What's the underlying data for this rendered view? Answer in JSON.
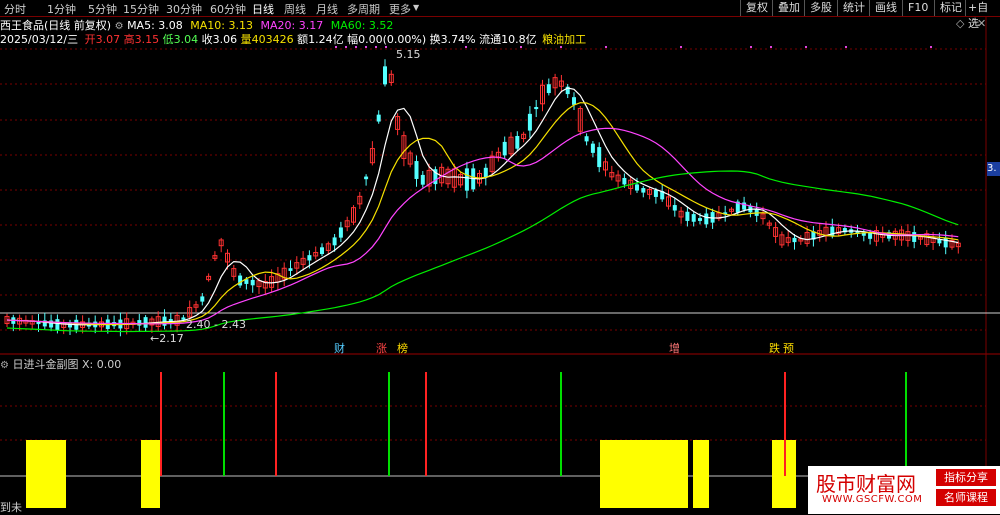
{
  "toolbar": {
    "periods": [
      {
        "label": "分时",
        "active": false
      },
      {
        "label": "1分钟",
        "active": false
      },
      {
        "label": "5分钟",
        "active": false
      },
      {
        "label": "15分钟",
        "active": false
      },
      {
        "label": "30分钟",
        "active": false
      },
      {
        "label": "60分钟",
        "active": false
      },
      {
        "label": "日线",
        "active": true
      },
      {
        "label": "周线",
        "active": false
      },
      {
        "label": "月线",
        "active": false
      },
      {
        "label": "多周期",
        "active": false
      },
      {
        "label": "更多",
        "active": false
      }
    ],
    "right_buttons": [
      "复权",
      "叠加",
      "多股",
      "统计",
      "画线",
      "F10",
      "标记",
      "+自选"
    ]
  },
  "stock": {
    "title": "西王食品(日线 前复权)",
    "ma": [
      {
        "label": "MA5: 3.08",
        "color": "#ffffff"
      },
      {
        "label": "MA10: 3.13",
        "color": "#f5e000"
      },
      {
        "label": "MA20: 3.17",
        "color": "#ff44ff"
      },
      {
        "label": "MA60: 3.52",
        "color": "#00ee00"
      }
    ],
    "date": "2025/03/12/三",
    "open_label": "开",
    "open": "3.07",
    "high_label": "高",
    "high": "3.15",
    "low_label": "低",
    "low": "3.04",
    "close_label": "收",
    "close": "3.06",
    "vol_label": "量",
    "vol": "403426",
    "amount_label": "额",
    "amount": "1.24亿",
    "change_label": "幅",
    "change": "0.00(0.00%)",
    "turnover_label": "换",
    "turnover": "3.74%",
    "float_label": "流通",
    "float": "10.8亿",
    "sector": "粮油加工"
  },
  "price_labels": {
    "max": "5.15",
    "min": "2.17",
    "range": "2.40 - 2.43",
    "axis_tag": "3."
  },
  "colors": {
    "up": "#ff3232",
    "down": "#54ffff",
    "bar_yellow": "#ffff00",
    "signal_green": "#00dd00",
    "signal_red": "#ff2222"
  },
  "events": [
    {
      "label": "财",
      "color": "#54ccff"
    },
    {
      "label": "涨",
      "color": "#ff4444"
    },
    {
      "label": "榜",
      "color": "#ffdd00"
    },
    {
      "label": "增",
      "color": "#ff7777"
    },
    {
      "label": "跌",
      "color": "#ffdd00"
    },
    {
      "label": "预",
      "color": "#ffdd00"
    }
  ],
  "sub": {
    "title": "日进斗金副图",
    "x_label": "X: 0.00",
    "bottom_left": "到未"
  },
  "logo": {
    "text": "股市财富网",
    "url": "WWW.GSCFW.COM",
    "badge1": "指标分享",
    "badge2": "名师课程"
  }
}
